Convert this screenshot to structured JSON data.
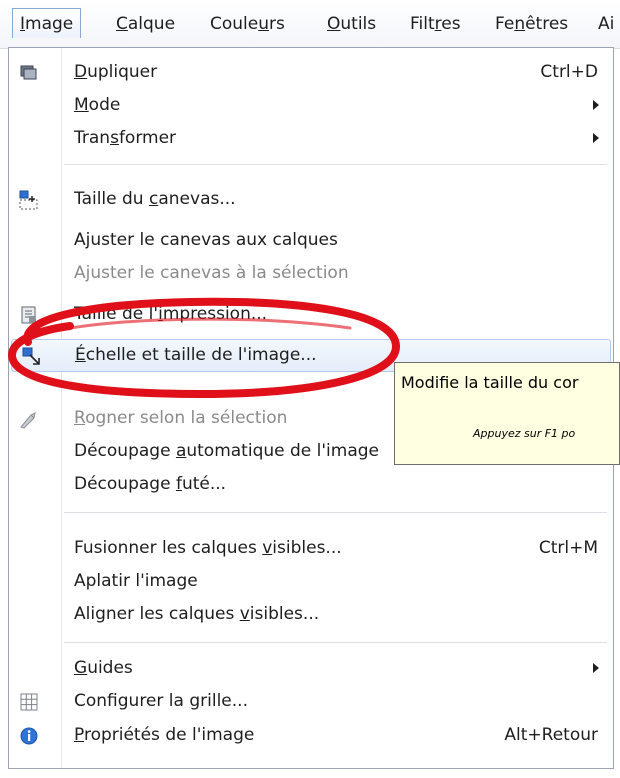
{
  "menubar": {
    "items": [
      {
        "pre": "",
        "mn": "I",
        "post": "mage"
      },
      {
        "pre": "",
        "mn": "C",
        "post": "alque"
      },
      {
        "pre": "Coule",
        "mn": "u",
        "post": "rs"
      },
      {
        "pre": "",
        "mn": "O",
        "post": "utils"
      },
      {
        "pre": "Filt",
        "mn": "r",
        "post": "es"
      },
      {
        "pre": "Fe",
        "mn": "n",
        "post": "êtres"
      },
      {
        "pre": "Ai",
        "mn": "",
        "post": ""
      }
    ]
  },
  "menu": {
    "items": [
      {
        "pre": "",
        "mn": "D",
        "post": "upliquer",
        "shortcut": "Ctrl+D"
      },
      {
        "pre": "",
        "mn": "M",
        "post": "ode"
      },
      {
        "pre": "Tran",
        "mn": "s",
        "post": "former"
      },
      {
        "pre": "Taille du ",
        "mn": "c",
        "post": "anevas..."
      },
      {
        "pre": "Ajuster le canevas aux calques",
        "mn": "",
        "post": ""
      },
      {
        "pre": "Ajuster le canevas à la sélection",
        "mn": "",
        "post": ""
      },
      {
        "pre": "Taille de l'",
        "mn": "i",
        "post": "mpression..."
      },
      {
        "pre": "",
        "mn": "É",
        "post": "chelle et taille de l'image..."
      },
      {
        "pre": "",
        "mn": "R",
        "post": "ogner selon la sélection"
      },
      {
        "pre": "Découpage ",
        "mn": "a",
        "post": "utomatique de l'image"
      },
      {
        "pre": "Découpage ",
        "mn": "f",
        "post": "uté..."
      },
      {
        "pre": "Fusionner les calques ",
        "mn": "v",
        "post": "isibles...",
        "shortcut": "Ctrl+M"
      },
      {
        "pre": "Aplatir l'image",
        "mn": "",
        "post": ""
      },
      {
        "pre": "Aligner les calques ",
        "mn": "v",
        "post": "isibles..."
      },
      {
        "pre": "",
        "mn": "G",
        "post": "uides"
      },
      {
        "pre": "Configurer la ",
        "mn": "g",
        "post": "rille..."
      },
      {
        "pre": "",
        "mn": "P",
        "post": "ropriétés de l'image",
        "shortcut": "Alt+Retour"
      }
    ]
  },
  "tooltip": {
    "title": "Modifie la taille du cor",
    "hint": "Appuyez sur F1 po"
  },
  "colors": {
    "annotation": "#e0101a",
    "tooltip_bg": "#ffffe1",
    "hover_bg": "#e4edf9"
  }
}
